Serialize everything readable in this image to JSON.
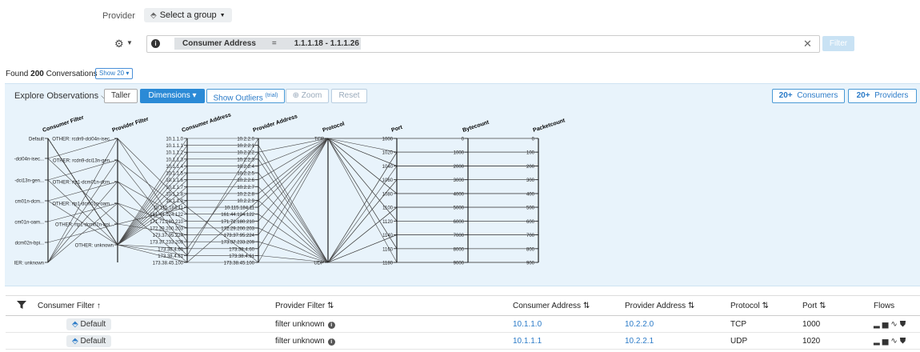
{
  "provider_label": "Provider",
  "select_group": "Select a group",
  "filter_bar": {
    "key": "Consumer Address",
    "operator": "=",
    "value": "1.1.1.18 - 1.1.1.26",
    "filter_button": "Filter"
  },
  "found": {
    "prefix": "Found",
    "count": "200",
    "suffix": "Conversations",
    "show": "Show 20"
  },
  "explore": {
    "title": "Explore Observations",
    "taller": "Taller",
    "dimensions": "Dimensions",
    "show_outliers": "Show Outliers",
    "trial": "(trial)",
    "zoom": "Zoom",
    "reset": "Reset",
    "consumers_count": "20+",
    "consumers": "Consumers",
    "providers_count": "20+",
    "providers": "Providers"
  },
  "chart_data": {
    "type": "parallel-coordinates",
    "axes": [
      {
        "name": "Consumer Filter",
        "ticks": [
          "Default",
          "-dci04n-isec...",
          "-dci13n-gen...",
          "cm01n-dcm...",
          "cm01n-oam...",
          "dcm02n-bpi...",
          "IER: unknown"
        ]
      },
      {
        "name": "Provider Filter",
        "ticks": [
          "OTHER: rcdn9-dci04n-isec...",
          "OTHER: rcdn9-dci13n-gen...",
          "OTHER: rtp1-dcm01n-dcm...",
          "OTHER: rtp1-dcm01n-oam...",
          "OTHER: rtp1-dcm02n-bpi...",
          "OTHER: unknown"
        ]
      },
      {
        "name": "Consumer Address",
        "ticks": [
          "10.1.1.0",
          "10.1.1.1",
          "10.1.1.2",
          "10.1.1.3",
          "10.1.1.4",
          "10.1.1.5",
          "10.1.1.6",
          "10.1.1.7",
          "10.1.1.8",
          "10.1.1.9",
          "10.115.184.11",
          "161.44.124.122",
          "171.71.180.210",
          "172.29.200.203",
          "173.37.95.224",
          "173.37.233.209",
          "173.38.4.60",
          "173.38.4.61",
          "173.38.45.100"
        ]
      },
      {
        "name": "Provider Address",
        "ticks": [
          "10.2.2.0",
          "10.2.2.1",
          "10.2.2.2",
          "10.2.2.3",
          "10.2.2.4",
          "10.2.2.5",
          "10.2.2.6",
          "10.2.2.7",
          "10.2.2.8",
          "10.2.2.9",
          "10.115.184.11",
          "161.44.124.122",
          "171.71.180.210",
          "172.29.200.203",
          "173.37.95.224",
          "173.37.233.209",
          "173.38.4.60",
          "173.38.4.61",
          "173.38.45.100"
        ]
      },
      {
        "name": "Protocol",
        "ticks": [
          "TCP",
          "UDP"
        ]
      },
      {
        "name": "Port",
        "ticks": [
          "1000",
          "1020",
          "1040",
          "1060",
          "1080",
          "1100",
          "1120",
          "1140",
          "1160",
          "1180"
        ]
      },
      {
        "name": "Bytecount",
        "ticks": [
          "0",
          "1000",
          "2000",
          "3000",
          "4000",
          "5000",
          "6000",
          "7000",
          "8000",
          "9000"
        ]
      },
      {
        "name": "Packetcount",
        "ticks": [
          "0",
          "100",
          "200",
          "300",
          "400",
          "500",
          "600",
          "700",
          "800",
          "900"
        ]
      }
    ]
  },
  "table": {
    "columns": [
      "Consumer Filter ↑",
      "Provider Filter ⇅",
      "Consumer Address ⇅",
      "Provider Address ⇅",
      "Protocol ⇅",
      "Port ⇅",
      "Flows"
    ],
    "rows": [
      {
        "consumer_filter": "Default",
        "provider_filter": "filter unknown",
        "consumer_address": "10.1.1.0",
        "provider_address": "10.2.2.0",
        "protocol": "TCP",
        "port": "1000"
      },
      {
        "consumer_filter": "Default",
        "provider_filter": "filter unknown",
        "consumer_address": "10.1.1.1",
        "provider_address": "10.2.2.1",
        "protocol": "UDP",
        "port": "1020"
      }
    ]
  },
  "colors": {
    "accent": "#2b8ad6",
    "panel": "#e8f3fb",
    "link": "#2b7bc8"
  }
}
